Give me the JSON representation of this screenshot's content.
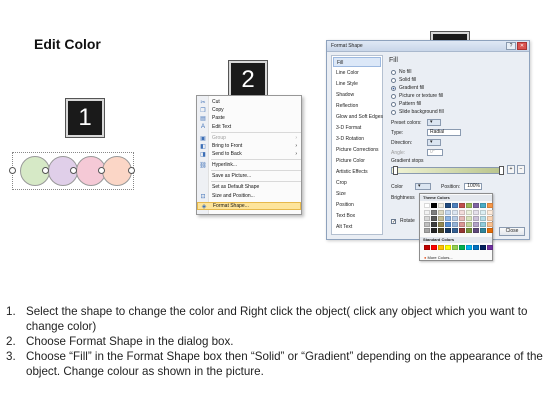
{
  "title": "Edit Color",
  "steps": {
    "s1": "1",
    "s2": "2",
    "s3": "3"
  },
  "shapes": {
    "colors": [
      "#d6e9c6",
      "#e0cfe9",
      "#f5c9d6",
      "#fbd6c6"
    ]
  },
  "context_menu": {
    "items": [
      {
        "icon": "cut-icon",
        "glyph": "✂",
        "label": "Cut"
      },
      {
        "icon": "copy-icon",
        "glyph": "❐",
        "label": "Copy"
      },
      {
        "icon": "paste-icon",
        "glyph": "▤",
        "label": "Paste"
      },
      {
        "icon": "edit-text-icon",
        "glyph": "A",
        "label": "Edit Text"
      },
      {
        "icon": "group-icon",
        "glyph": "▣",
        "label": "Group"
      },
      {
        "icon": "bring-front-icon",
        "glyph": "◧",
        "label": "Bring to Front"
      },
      {
        "icon": "send-back-icon",
        "glyph": "◨",
        "label": "Send to Back"
      },
      {
        "icon": "hyperlink-icon",
        "glyph": "⛓",
        "label": "Hyperlink..."
      },
      {
        "icon": "save-picture-icon",
        "glyph": "",
        "label": "Save as Picture..."
      },
      {
        "icon": "default-shape-icon",
        "glyph": "",
        "label": "Set as Default Shape"
      },
      {
        "icon": "size-position-icon",
        "glyph": "⊡",
        "label": "Size and Position..."
      },
      {
        "icon": "format-shape-icon",
        "glyph": "◈",
        "label": "Format Shape..."
      }
    ]
  },
  "dialog": {
    "title": "Format Shape",
    "nav": [
      "Fill",
      "Line Color",
      "Line Style",
      "Shadow",
      "Reflection",
      "Glow and Soft Edges",
      "3-D Format",
      "3-D Rotation",
      "Picture Corrections",
      "Picture Color",
      "Artistic Effects",
      "Crop",
      "Size",
      "Position",
      "Text Box",
      "Alt Text"
    ],
    "pane_title": "Fill",
    "fill_options": [
      "No fill",
      "Solid fill",
      "Gradient fill",
      "Picture or texture fill",
      "Pattern fill",
      "Slide background fill"
    ],
    "preset_colors_label": "Preset colors:",
    "type_label": "Type:",
    "type_value": "Radial",
    "direction_label": "Direction:",
    "angle_label": "Angle:",
    "angle_value": "0°",
    "gradient_stops_label": "Gradient stops",
    "color_label": "Color",
    "position_label": "Position:",
    "position_value": "100%",
    "brightness_label": "Brightness",
    "rotate_label": "Rotate",
    "close_label": "Close"
  },
  "palette": {
    "theme_label": "Theme Colors",
    "standard_label": "Standard Colors",
    "more_label": "More Colors...",
    "theme_top": [
      "#ffffff",
      "#000000",
      "#eeece1",
      "#1f497d",
      "#4f81bd",
      "#c0504d",
      "#9bbb59",
      "#8064a2",
      "#4bacc6",
      "#f79646"
    ],
    "theme_shades": [
      [
        "#f2f2f2",
        "#7f7f7f",
        "#ddd9c3",
        "#c6d9f0",
        "#dbe5f1",
        "#f2dcdb",
        "#ebf1dd",
        "#e5e0ec",
        "#dbeef3",
        "#fdeada"
      ],
      [
        "#d8d8d8",
        "#595959",
        "#c4bd97",
        "#8db3e2",
        "#b8cce4",
        "#e5b9b7",
        "#d7e3bc",
        "#ccc1d9",
        "#b7dde8",
        "#fbd5b5"
      ],
      [
        "#bfbfbf",
        "#3f3f3f",
        "#938953",
        "#548dd4",
        "#95b3d7",
        "#d99694",
        "#c3d69b",
        "#b2a2c7",
        "#92cddc",
        "#fac08f"
      ],
      [
        "#a5a5a5",
        "#262626",
        "#494429",
        "#17365d",
        "#366092",
        "#953734",
        "#76923c",
        "#5f497a",
        "#31859b",
        "#e36c09"
      ]
    ],
    "standard": [
      "#c00000",
      "#ff0000",
      "#ffc000",
      "#ffff00",
      "#92d050",
      "#00b050",
      "#00b0f0",
      "#0070c0",
      "#002060",
      "#7030a0"
    ]
  },
  "instructions": [
    {
      "n": "1.",
      "text": "Select the shape to change the color and Right click the object( click any object which you want to change color)"
    },
    {
      "n": "2.",
      "text": "Choose Format Shape in the dialog box."
    },
    {
      "n": "3.",
      "text": "Choose “Fill” in the Format Shape box then “Solid” or “Gradient” depending on the appearance of the object. Change colour as shown in the picture."
    }
  ]
}
